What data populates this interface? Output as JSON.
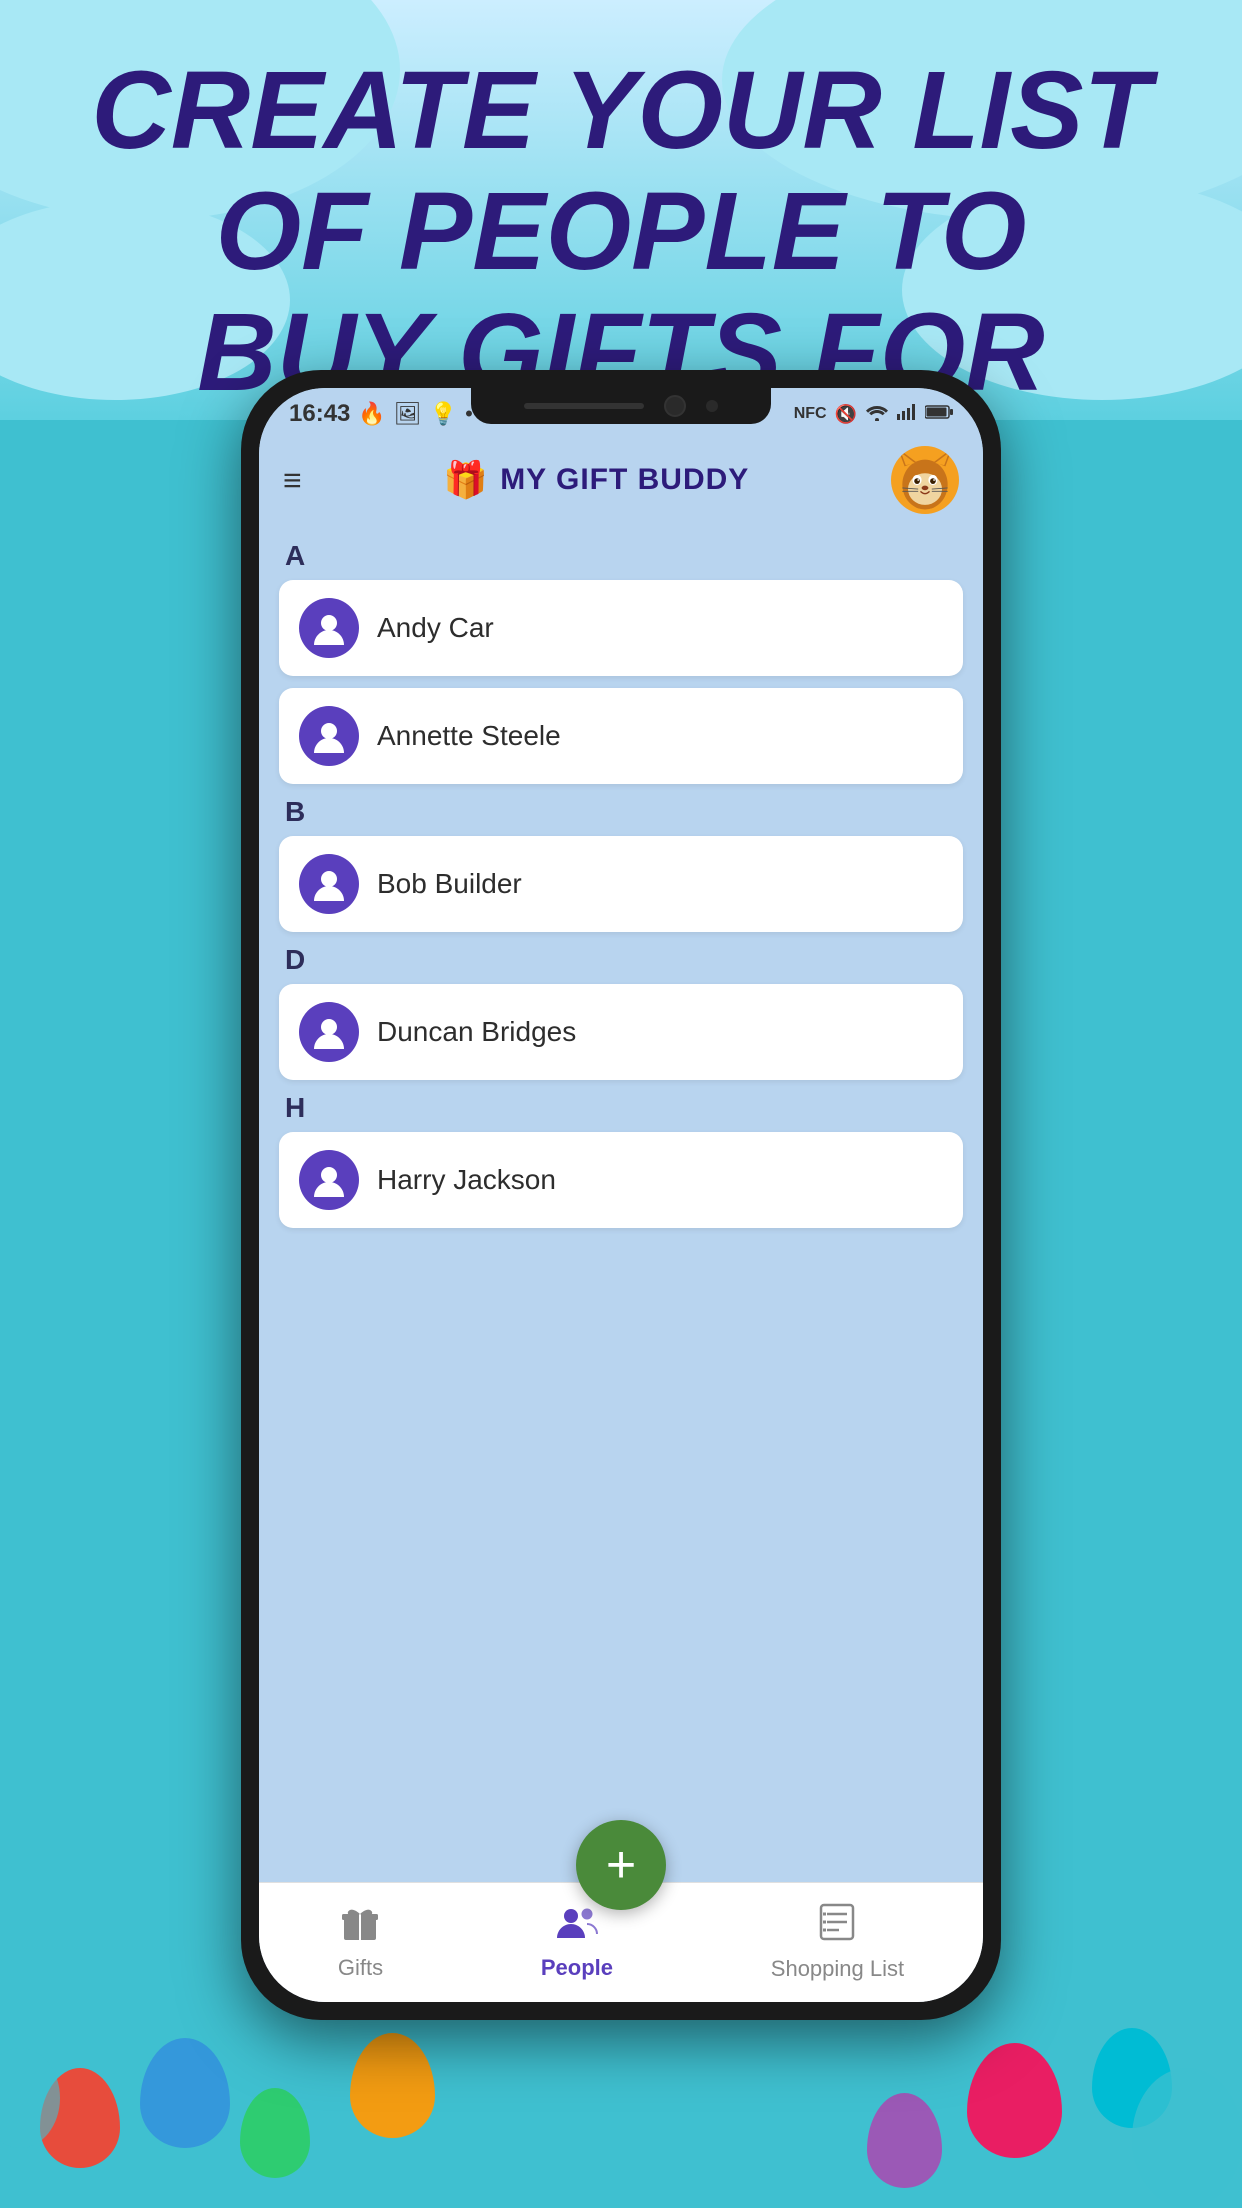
{
  "hero": {
    "title_line1": "CREATE YOUR LIST",
    "title_line2": "OF PEOPLE TO",
    "title_line3": "BUY GIFTS FOR"
  },
  "status_bar": {
    "time": "16:43",
    "icons_left": [
      "🔥",
      "🖼",
      "💡",
      "•"
    ],
    "icons_right": [
      "NFC",
      "🔇",
      "WiFi",
      "signal",
      "🔋"
    ]
  },
  "header": {
    "app_name": "MY GIFT BUDDY",
    "menu_icon": "≡",
    "gift_emoji": "🎁"
  },
  "people_sections": [
    {
      "letter": "A",
      "people": [
        {
          "name": "Andy Car"
        },
        {
          "name": "Annette Steele"
        }
      ]
    },
    {
      "letter": "B",
      "people": [
        {
          "name": "Bob Builder"
        }
      ]
    },
    {
      "letter": "D",
      "people": [
        {
          "name": "Duncan Bridges"
        }
      ]
    },
    {
      "letter": "H",
      "people": [
        {
          "name": "Harry Jackson"
        }
      ]
    }
  ],
  "fab": {
    "label": "+"
  },
  "bottom_nav": {
    "items": [
      {
        "label": "Gifts",
        "icon": "🎁",
        "active": false
      },
      {
        "label": "People",
        "icon": "👥",
        "active": true
      },
      {
        "label": "Shopping List",
        "icon": "📋",
        "active": false
      }
    ]
  },
  "colors": {
    "accent_purple": "#5a3fbd",
    "bg_blue": "#b8d4ef",
    "hero_text": "#2d1b7a",
    "active_nav": "#5a3fbd"
  }
}
